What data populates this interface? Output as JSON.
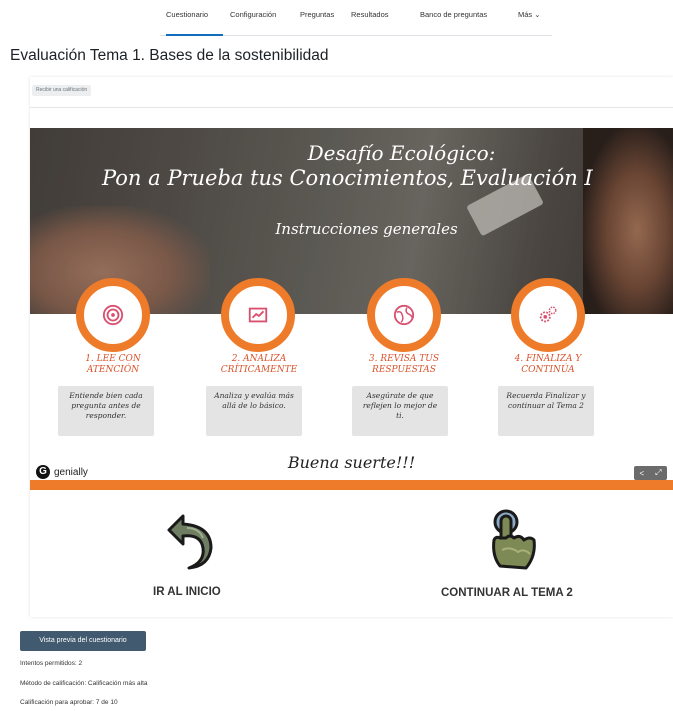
{
  "nav": {
    "tabs": [
      {
        "label": "Cuestionario",
        "active": true
      },
      {
        "label": "Configuración",
        "active": false
      },
      {
        "label": "Preguntas",
        "active": false
      },
      {
        "label": "Resultados",
        "active": false
      },
      {
        "label": "Banco de preguntas",
        "active": false
      },
      {
        "label": "Más ⌄",
        "active": false
      }
    ]
  },
  "page": {
    "title": "Evaluación Tema 1. Bases de la sostenibilidad",
    "completion_badge": "Recibir una calificación"
  },
  "embed": {
    "title_line1": "Desafío Ecológico:",
    "title_line2": "Pon a Prueba tus Conocimientos, Evaluación I",
    "subtitle": "Instrucciones generales",
    "steps": [
      {
        "title": "1. LEE CON ATENCIÓN",
        "text": "Entiende bien cada pregunta antes de responder.",
        "icon": "target-icon"
      },
      {
        "title": "2. ANALIZA CRÍTICAMENTE",
        "text": "Analiza y evalúa más allá de lo básico.",
        "icon": "chart-icon"
      },
      {
        "title": "3. REVISA TUS RESPUESTAS",
        "text": "Asegúrate de que reflejen lo mejor de ti.",
        "icon": "globe-icon"
      },
      {
        "title": "4. FINALIZA Y CONTINÚA",
        "text": "Recuerda Finalizar y continuar al Tema 2",
        "icon": "gear-icon"
      }
    ],
    "good_luck": "Buena suerte!!!",
    "logo_text": "genially",
    "accent_color": "#ee7b2a"
  },
  "buttons": {
    "start_label": "IR AL INICIO",
    "continue_label": "CONTINUAR AL TEMA 2"
  },
  "quiz": {
    "preview_button": "Vista previa del cuestionario",
    "attempts": "Intentos permitidos: 2",
    "grading_method": "Método de calificación: Calificación más alta",
    "pass_grade": "Calificación para aprobar: 7 de 10"
  }
}
